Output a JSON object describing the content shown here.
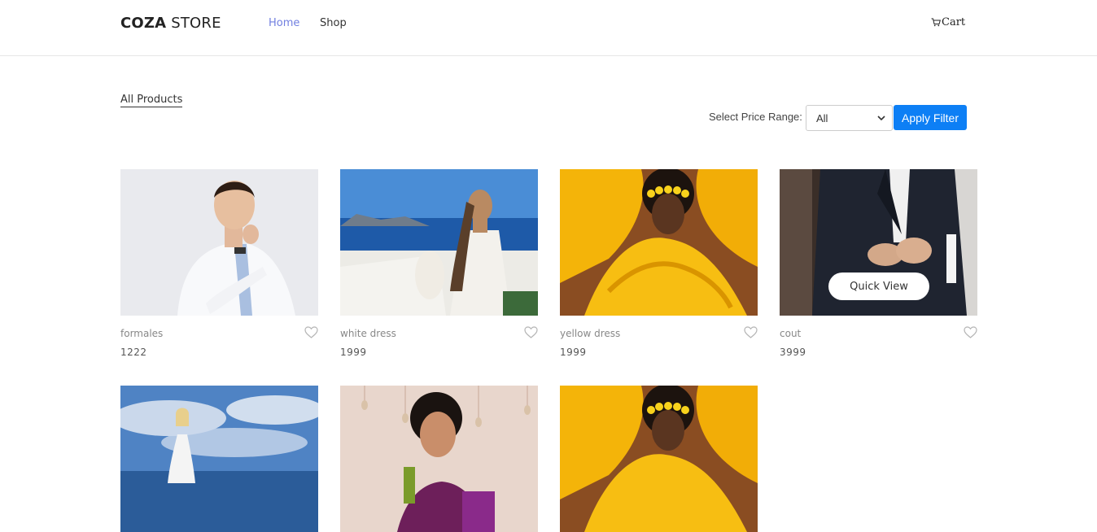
{
  "header": {
    "logo_bold": "COZA",
    "logo_regular": " STORE",
    "nav": [
      {
        "label": "Home",
        "active": true
      },
      {
        "label": "Shop",
        "active": false
      }
    ],
    "cart_label": "Cart"
  },
  "main": {
    "section_title": "All Products",
    "filter": {
      "label": "Select Price Range:",
      "selected": "All",
      "apply_label": "Apply Filter"
    },
    "products": [
      {
        "name": "formales",
        "price": "1222",
        "image": "man-white-shirt"
      },
      {
        "name": "white dress",
        "price": "1999",
        "image": "woman-white-dress-sea"
      },
      {
        "name": "yellow dress",
        "price": "1999",
        "image": "woman-yellow-dress"
      },
      {
        "name": "cout",
        "price": "3999",
        "image": "man-black-suit"
      },
      {
        "name": "",
        "price": "",
        "image": "woman-white-dress-beach"
      },
      {
        "name": "",
        "price": "",
        "image": "woman-saree-jewelry"
      },
      {
        "name": "",
        "price": "",
        "image": "woman-yellow-dress"
      }
    ],
    "quick_view_label": "Quick View"
  },
  "colors": {
    "accent": "#717fe0",
    "button": "#0d7ff5"
  },
  "icons": [
    "cart-icon",
    "heart-icon",
    "chevron-down-icon"
  ]
}
